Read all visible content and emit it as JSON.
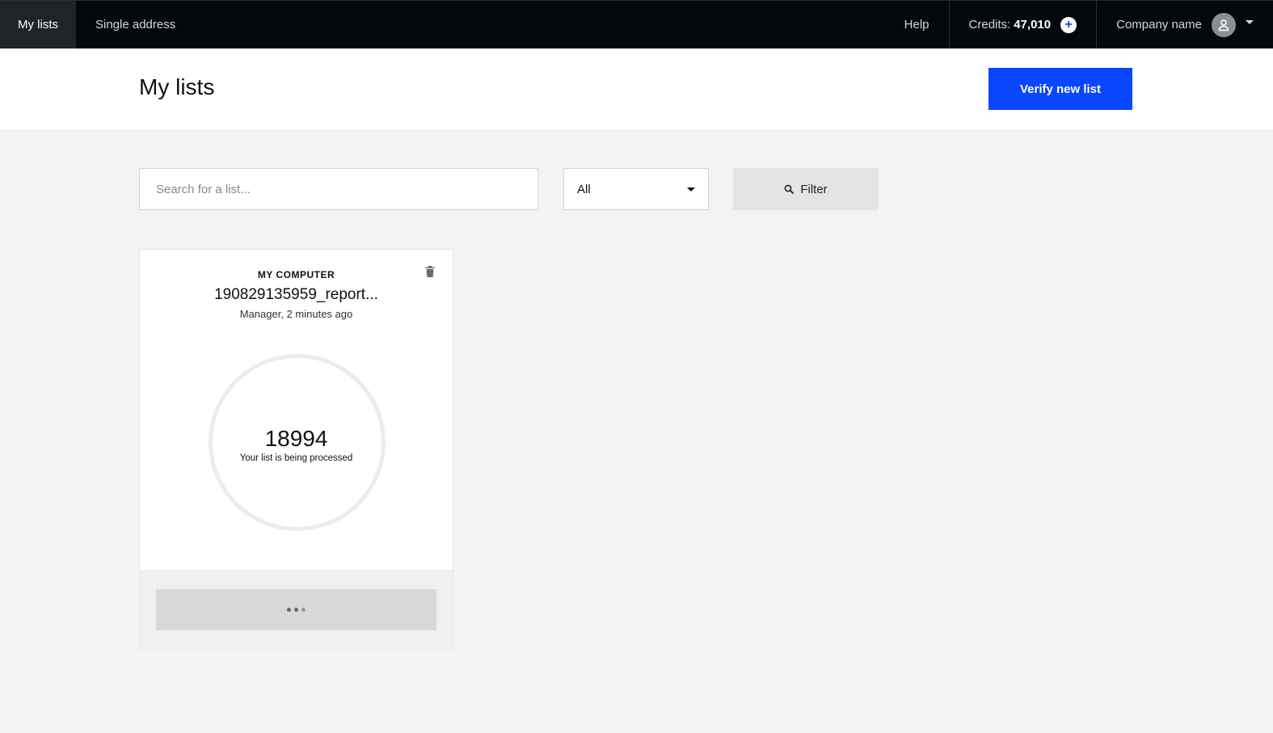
{
  "nav": {
    "tabs": [
      {
        "label": "My lists",
        "active": true
      },
      {
        "label": "Single address",
        "active": false
      }
    ],
    "help_label": "Help",
    "credits_label": "Credits:",
    "credits_value": "47,010",
    "company_name": "Company name"
  },
  "header": {
    "title": "My lists",
    "verify_button": "Verify new list"
  },
  "filters": {
    "search_placeholder": "Search for a list...",
    "select_value": "All",
    "filter_button": "Filter"
  },
  "card": {
    "source": "MY COMPUTER",
    "filename": "190829135959_report...",
    "meta": "Manager, 2 minutes ago",
    "count": "18994",
    "status": "Your list is being processed"
  },
  "colors": {
    "accent": "#0a45ff",
    "nav_bg": "#05080b",
    "page_bg": "#f3f3f3"
  }
}
